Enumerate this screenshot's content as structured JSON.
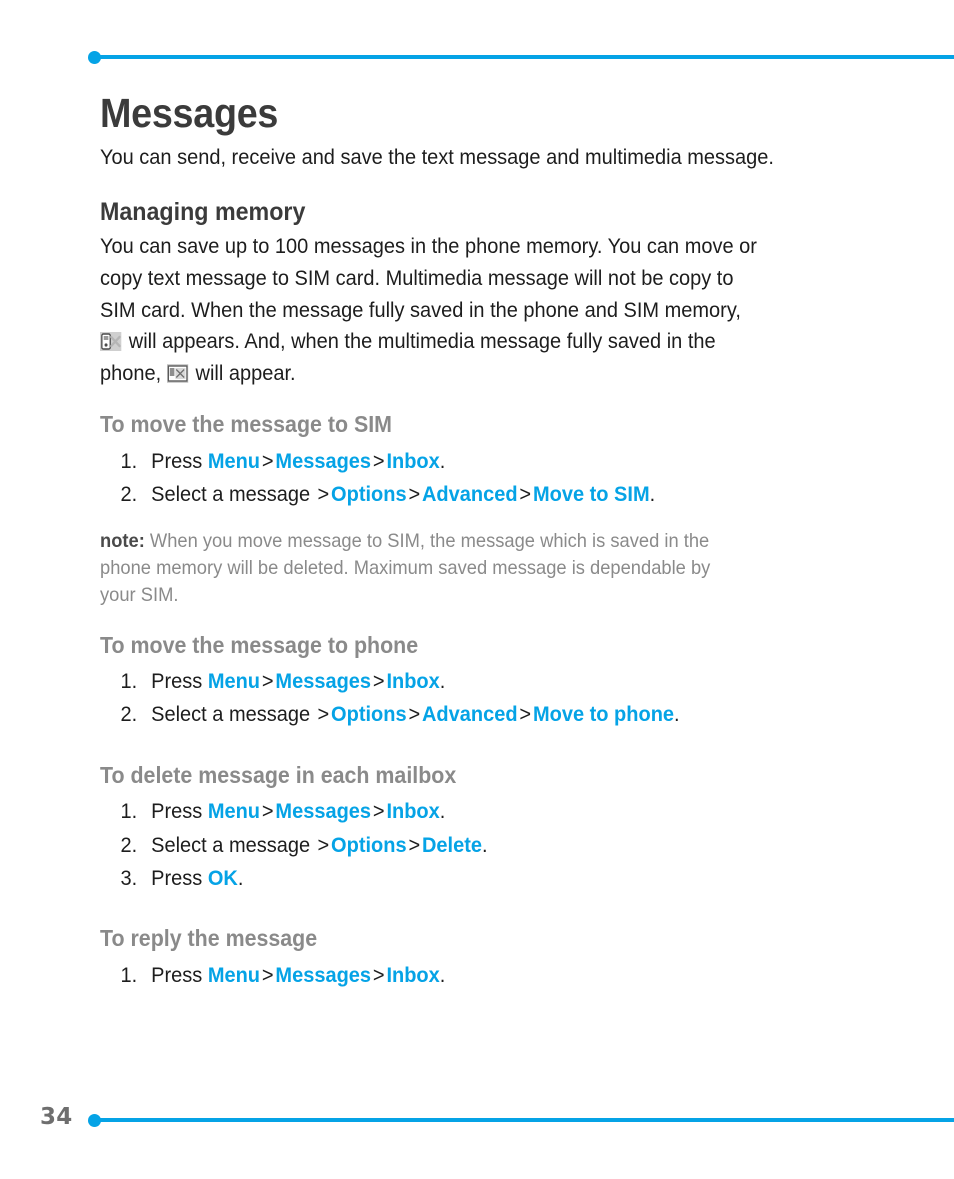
{
  "page": {
    "number": "34",
    "accent_color": "#05A3E6",
    "title": "Messages",
    "intro": "You can send, receive and save the text message and multimedia message."
  },
  "managing_memory": {
    "heading": "Managing memory",
    "lines": [
      "You can save up to 100 messages in the phone memory. You can move or",
      "copy text message to SIM card. Multimedia message will not be copy to",
      "SIM card. When the message fully saved in the phone and SIM memory,",
      " will appears. And, when the multimedia message fully saved in the",
      "phone,  will appear."
    ],
    "line_4_after_icon": " will appears. And, when the multimedia message fully saved in the",
    "line_5_before_icon": "phone,",
    "line_5_after_icon": " will appear.",
    "icon_sim_memory": "sim-memory-full-icon",
    "icon_mms_memory": "mms-memory-full-icon"
  },
  "sections": [
    {
      "heading": "To move the message to SIM",
      "steps": [
        {
          "num": "1.",
          "parts": [
            {
              "type": "text",
              "value": "Press "
            },
            {
              "type": "kw",
              "value": "Menu"
            },
            {
              "type": "sep",
              "value": ">"
            },
            {
              "type": "kw",
              "value": "Messages"
            },
            {
              "type": "sep",
              "value": ">"
            },
            {
              "type": "kw",
              "value": "Inbox"
            },
            {
              "type": "text",
              "value": "."
            }
          ]
        },
        {
          "num": "2.",
          "parts": [
            {
              "type": "text",
              "value": "Select a message "
            },
            {
              "type": "sep",
              "value": ">"
            },
            {
              "type": "kw",
              "value": "Options"
            },
            {
              "type": "sep",
              "value": ">"
            },
            {
              "type": "kw",
              "value": "Advanced"
            },
            {
              "type": "sep",
              "value": ">"
            },
            {
              "type": "kw",
              "value": "Move to SIM"
            },
            {
              "type": "text",
              "value": "."
            }
          ]
        }
      ],
      "note": {
        "label": "note:",
        "lines": [
          " When you move message to SIM, the message which is saved in the",
          "phone memory will be deleted. Maximum saved message is dependable by",
          "your SIM."
        ]
      }
    },
    {
      "heading": "To move the message to phone",
      "steps": [
        {
          "num": "1.",
          "parts": [
            {
              "type": "text",
              "value": "Press "
            },
            {
              "type": "kw",
              "value": "Menu"
            },
            {
              "type": "sep",
              "value": ">"
            },
            {
              "type": "kw",
              "value": "Messages"
            },
            {
              "type": "sep",
              "value": ">"
            },
            {
              "type": "kw",
              "value": "Inbox"
            },
            {
              "type": "text",
              "value": "."
            }
          ]
        },
        {
          "num": "2.",
          "parts": [
            {
              "type": "text",
              "value": "Select a message "
            },
            {
              "type": "sep",
              "value": ">"
            },
            {
              "type": "kw",
              "value": "Options"
            },
            {
              "type": "sep",
              "value": ">"
            },
            {
              "type": "kw",
              "value": "Advanced"
            },
            {
              "type": "sep",
              "value": ">"
            },
            {
              "type": "kw",
              "value": "Move to phone"
            },
            {
              "type": "text",
              "value": "."
            }
          ]
        }
      ],
      "note": null
    },
    {
      "heading": "To delete message in each mailbox",
      "steps": [
        {
          "num": "1.",
          "parts": [
            {
              "type": "text",
              "value": "Press "
            },
            {
              "type": "kw",
              "value": "Menu"
            },
            {
              "type": "sep",
              "value": ">"
            },
            {
              "type": "kw",
              "value": "Messages"
            },
            {
              "type": "sep",
              "value": ">"
            },
            {
              "type": "kw",
              "value": "Inbox"
            },
            {
              "type": "text",
              "value": "."
            }
          ]
        },
        {
          "num": "2.",
          "parts": [
            {
              "type": "text",
              "value": "Select a message "
            },
            {
              "type": "sep",
              "value": ">"
            },
            {
              "type": "kw",
              "value": "Options"
            },
            {
              "type": "sep",
              "value": ">"
            },
            {
              "type": "kw",
              "value": "Delete"
            },
            {
              "type": "text",
              "value": "."
            }
          ]
        },
        {
          "num": "3.",
          "parts": [
            {
              "type": "text",
              "value": "Press "
            },
            {
              "type": "kw",
              "value": "OK"
            },
            {
              "type": "text",
              "value": "."
            }
          ]
        }
      ],
      "note": null
    },
    {
      "heading": "To reply the message",
      "steps": [
        {
          "num": "1.",
          "parts": [
            {
              "type": "text",
              "value": "Press "
            },
            {
              "type": "kw",
              "value": "Menu"
            },
            {
              "type": "sep",
              "value": ">"
            },
            {
              "type": "kw",
              "value": "Messages"
            },
            {
              "type": "sep",
              "value": ">"
            },
            {
              "type": "kw",
              "value": "Inbox"
            },
            {
              "type": "text",
              "value": "."
            }
          ]
        }
      ],
      "note": null
    }
  ]
}
